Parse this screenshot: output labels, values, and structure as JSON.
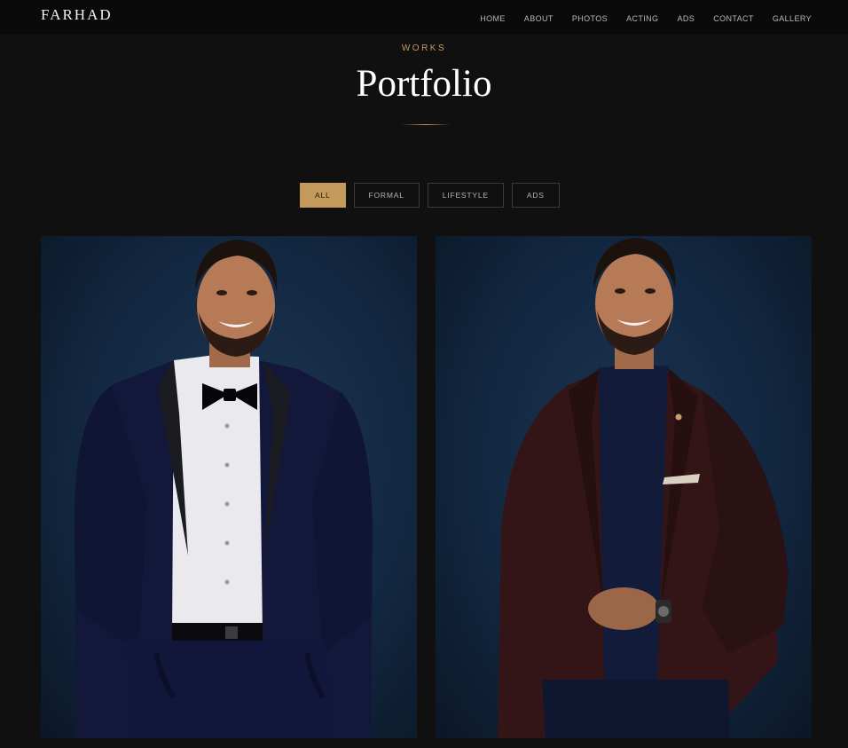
{
  "brand": {
    "name": "FARHAD"
  },
  "nav": {
    "items": [
      "HOME",
      "ABOUT",
      "PHOTOS",
      "ACTING",
      "ADS",
      "CONTACT",
      "GALLERY"
    ]
  },
  "section": {
    "eyebrow": "WORKS",
    "title": "Portfolio"
  },
  "filters": {
    "items": [
      "ALL",
      "FORMAL",
      "LIFESTYLE",
      "ADS"
    ],
    "active": "ALL"
  },
  "colors": {
    "accent": "#c39a5a",
    "background": "#101010",
    "header": "#0a0a0a",
    "photo_backdrop": "#132841"
  },
  "gallery": {
    "items": [
      {
        "subject": "man-in-navy-tuxedo-with-bow-tie"
      },
      {
        "subject": "man-in-burgundy-blazer"
      }
    ]
  }
}
